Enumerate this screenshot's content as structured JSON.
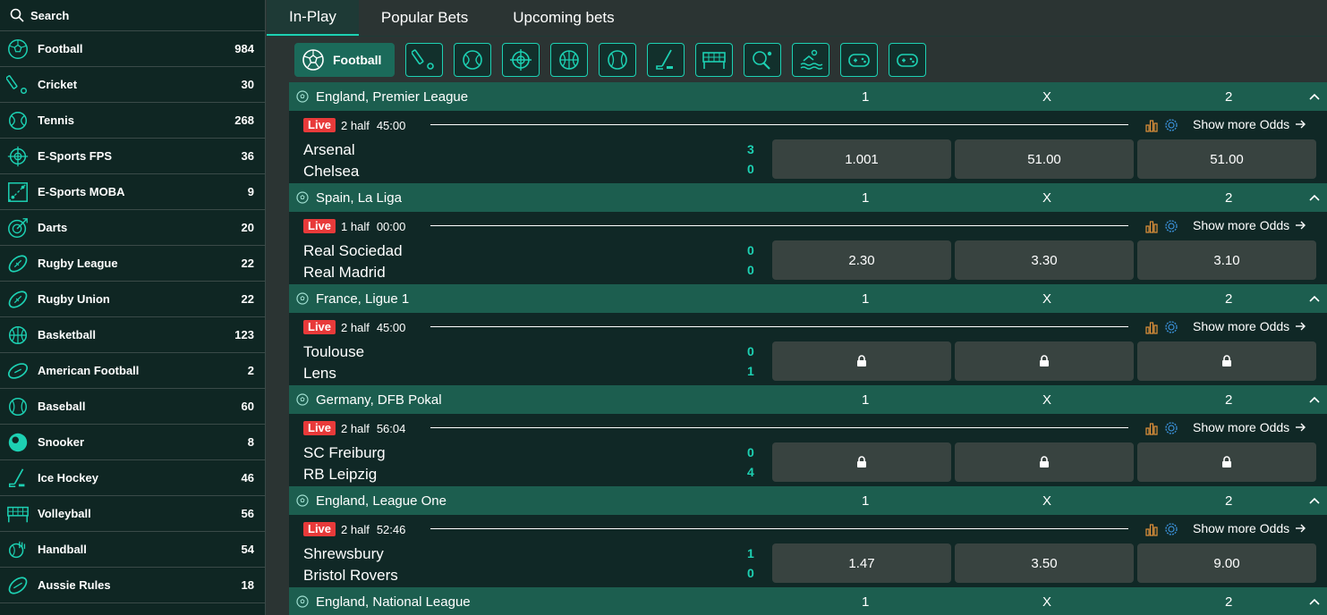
{
  "search": {
    "label": "Search"
  },
  "sidebar": {
    "items": [
      {
        "label": "Football",
        "count": "984",
        "icon": "football-icon"
      },
      {
        "label": "Cricket",
        "count": "30",
        "icon": "cricket-icon"
      },
      {
        "label": "Tennis",
        "count": "268",
        "icon": "tennis-icon"
      },
      {
        "label": "E-Sports FPS",
        "count": "36",
        "icon": "crosshair-icon"
      },
      {
        "label": "E-Sports MOBA",
        "count": "9",
        "icon": "moba-map-icon"
      },
      {
        "label": "Darts",
        "count": "20",
        "icon": "darts-icon"
      },
      {
        "label": "Rugby League",
        "count": "22",
        "icon": "rugby-ball-icon"
      },
      {
        "label": "Rugby Union",
        "count": "22",
        "icon": "rugby-ball-icon"
      },
      {
        "label": "Basketball",
        "count": "123",
        "icon": "basketball-icon"
      },
      {
        "label": "American Football",
        "count": "2",
        "icon": "american-football-icon"
      },
      {
        "label": "Baseball",
        "count": "60",
        "icon": "baseball-icon"
      },
      {
        "label": "Snooker",
        "count": "8",
        "icon": "snooker-ball-icon"
      },
      {
        "label": "Ice Hockey",
        "count": "46",
        "icon": "ice-hockey-icon"
      },
      {
        "label": "Volleyball",
        "count": "56",
        "icon": "volleyball-net-icon"
      },
      {
        "label": "Handball",
        "count": "54",
        "icon": "handball-icon"
      },
      {
        "label": "Aussie Rules",
        "count": "18",
        "icon": "aussie-rules-icon"
      }
    ]
  },
  "tabs": [
    {
      "label": "In-Play",
      "active": true
    },
    {
      "label": "Popular Bets",
      "active": false
    },
    {
      "label": "Upcoming bets",
      "active": false
    }
  ],
  "sport_filter": {
    "active_label": "Football",
    "icons": [
      "cricket-icon",
      "tennis-icon",
      "crosshair-icon",
      "basketball-icon",
      "baseball-icon",
      "ice-hockey-icon",
      "volleyball-net-icon",
      "table-tennis-icon",
      "water-polo-icon",
      "gamepad-icon",
      "gamepad-icon"
    ]
  },
  "colors": {
    "accent": "#1dd1b3",
    "league_bar": "#1c5e4f",
    "live": "#e83a3a",
    "sidebar_bg": "#0f2623"
  },
  "market_headers": {
    "h1": "1",
    "hx": "X",
    "h2": "2"
  },
  "live_label": "Live",
  "more_label": "Show more Odds",
  "events": [
    {
      "league": "England, Premier League",
      "period": "2 half",
      "time": "45:00",
      "home": "Arsenal",
      "away": "Chelsea",
      "home_score": "3",
      "away_score": "0",
      "odds": [
        "1.001",
        "51.00",
        "51.00"
      ],
      "locked": false
    },
    {
      "league": "Spain, La Liga",
      "period": "1 half",
      "time": "00:00",
      "home": "Real Sociedad",
      "away": "Real Madrid",
      "home_score": "0",
      "away_score": "0",
      "odds": [
        "2.30",
        "3.30",
        "3.10"
      ],
      "locked": false
    },
    {
      "league": "France, Ligue 1",
      "period": "2 half",
      "time": "45:00",
      "home": "Toulouse",
      "away": "Lens",
      "home_score": "0",
      "away_score": "1",
      "odds": [
        "",
        "",
        ""
      ],
      "locked": true
    },
    {
      "league": "Germany, DFB Pokal",
      "period": "2 half",
      "time": "56:04",
      "home": "SC Freiburg",
      "away": "RB Leipzig",
      "home_score": "0",
      "away_score": "4",
      "odds": [
        "",
        "",
        ""
      ],
      "locked": true
    },
    {
      "league": "England, League One",
      "period": "2 half",
      "time": "52:46",
      "home": "Shrewsbury",
      "away": "Bristol Rovers",
      "home_score": "1",
      "away_score": "0",
      "odds": [
        "1.47",
        "3.50",
        "9.00"
      ],
      "locked": false
    }
  ],
  "last_league": "England, National League"
}
